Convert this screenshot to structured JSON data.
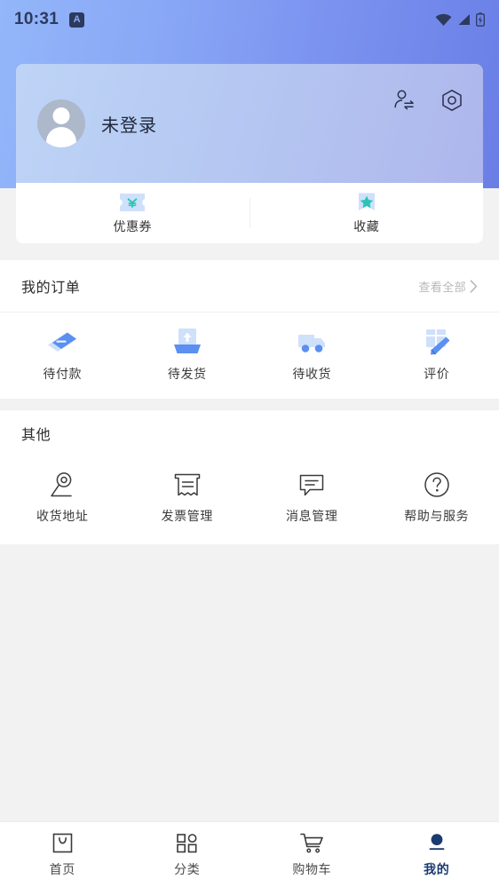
{
  "status_bar": {
    "time": "10:31",
    "badge_letter": "A",
    "icons": [
      "wifi-icon",
      "signal-icon",
      "battery-icon"
    ]
  },
  "profile": {
    "name": "未登录",
    "avatar_icon": "default-avatar-icon",
    "actions": [
      {
        "name": "switch-account-icon",
        "label": "切换账号"
      },
      {
        "name": "settings-icon",
        "label": "设置"
      }
    ]
  },
  "quick_row": [
    {
      "label": "优惠券",
      "icon": "coupon-icon"
    },
    {
      "label": "收藏",
      "icon": "favorite-bookmark-icon"
    }
  ],
  "orders": {
    "title": "我的订单",
    "more_label": "查看全部",
    "more_icon": "chevron-right-icon",
    "items": [
      {
        "label": "待付款",
        "icon": "payment-card-icon"
      },
      {
        "label": "待发货",
        "icon": "ship-box-icon"
      },
      {
        "label": "待收货",
        "icon": "delivery-truck-icon"
      },
      {
        "label": "评价",
        "icon": "review-pen-icon"
      }
    ]
  },
  "other": {
    "title": "其他",
    "items": [
      {
        "label": "收货地址",
        "icon": "location-pin-icon"
      },
      {
        "label": "发票管理",
        "icon": "invoice-icon"
      },
      {
        "label": "消息管理",
        "icon": "message-bubble-icon"
      },
      {
        "label": "帮助与服务",
        "icon": "help-question-icon"
      }
    ]
  },
  "bottom_nav": {
    "active_index": 3,
    "items": [
      {
        "label": "首页",
        "icon": "home-bag-icon"
      },
      {
        "label": "分类",
        "icon": "category-grid-icon"
      },
      {
        "label": "购物车",
        "icon": "shopping-cart-icon"
      },
      {
        "label": "我的",
        "icon": "profile-icon"
      }
    ]
  },
  "colors": {
    "header_gradient_start": "#93b6f9",
    "header_gradient_end": "#6a7ee6",
    "card_gradient_start": "#bed4f6",
    "card_gradient_end": "#aeb6ec",
    "accent_blue": "#5b8ff0",
    "accent_teal": "#2bc4b4",
    "active_nav": "#1b3a70",
    "page_bg": "#f2f2f2"
  }
}
